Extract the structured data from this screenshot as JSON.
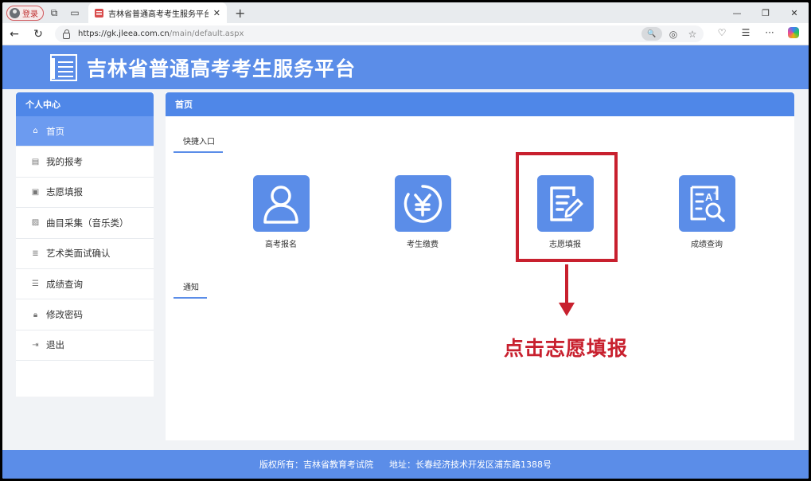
{
  "browser": {
    "profile_label": "登录",
    "tab_title": "吉林省普通高考考生服务平台",
    "url_host": "https://gk.jleea.com.cn",
    "url_path": "/main/default.aspx"
  },
  "site": {
    "title": "吉林省普通高考考生服务平台"
  },
  "sidebar": {
    "heading": "个人中心",
    "items": [
      {
        "label": "首页",
        "icon": "home-icon",
        "active": true
      },
      {
        "label": "我的报考",
        "icon": "document-icon"
      },
      {
        "label": "志愿填报",
        "icon": "form-icon"
      },
      {
        "label": "曲目采集（音乐类）",
        "icon": "edit-icon"
      },
      {
        "label": "艺术类面试确认",
        "icon": "list-icon"
      },
      {
        "label": "成绩查询",
        "icon": "chart-icon"
      },
      {
        "label": "修改密码",
        "icon": "lock-icon"
      },
      {
        "label": "退出",
        "icon": "logout-icon"
      }
    ]
  },
  "main": {
    "heading": "首页",
    "quick_entry_label": "快捷入口",
    "notice_label": "通知",
    "tiles": [
      {
        "label": "高考报名",
        "icon": "user-icon"
      },
      {
        "label": "考生缴费",
        "icon": "yen-icon"
      },
      {
        "label": "志愿填报",
        "icon": "form-edit-icon"
      },
      {
        "label": "成绩查询",
        "icon": "score-search-icon"
      }
    ]
  },
  "annotation": {
    "text": "点击志愿填报",
    "color": "#c8202e"
  },
  "footer": {
    "copyright": "版权所有：吉林省教育考试院",
    "address": "地址：长春经济技术开发区浦东路1388号"
  },
  "colors": {
    "primary": "#5b8de8",
    "header_blue": "#4f87e8",
    "highlight_red": "#c8202e"
  }
}
